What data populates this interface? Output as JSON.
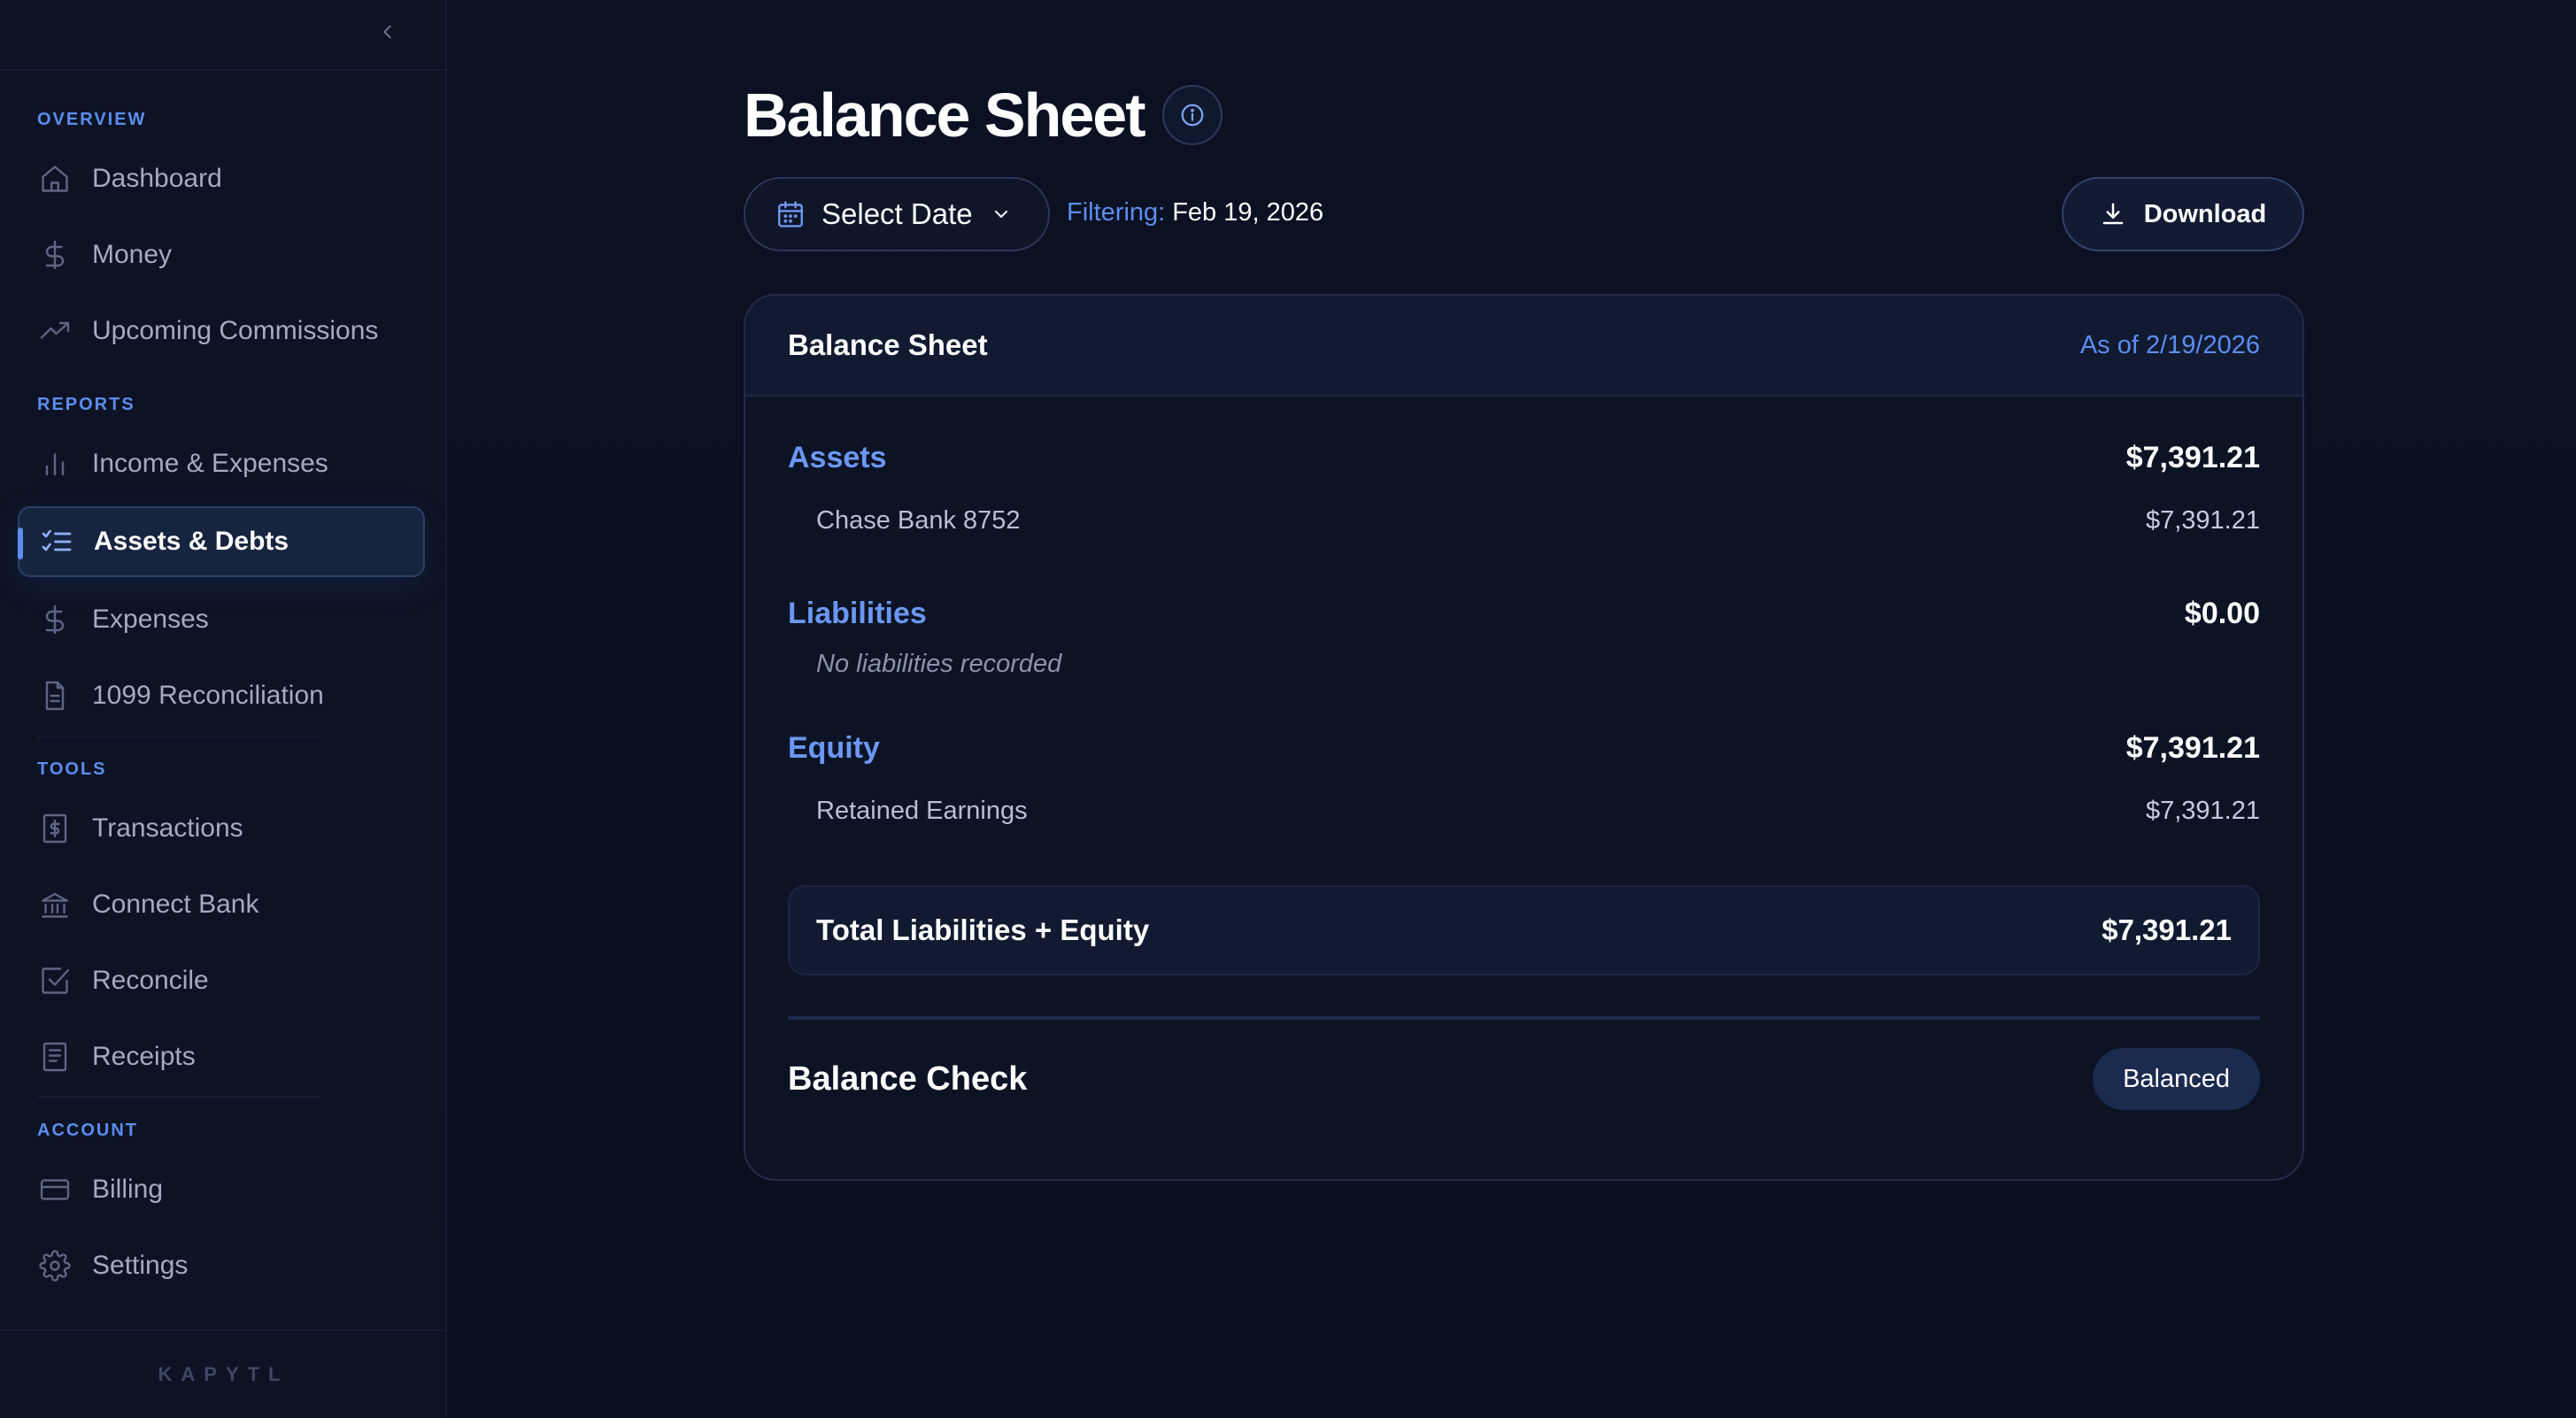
{
  "sidebar": {
    "sections": {
      "overview": "OVERVIEW",
      "reports": "REPORTS",
      "tools": "TOOLS",
      "account": "ACCOUNT"
    },
    "items": {
      "dashboard": "Dashboard",
      "money": "Money",
      "upcoming_commissions": "Upcoming Commissions",
      "income_expenses": "Income & Expenses",
      "assets_debts": "Assets & Debts",
      "expenses": "Expenses",
      "reconciliation_1099": "1099 Reconciliation",
      "transactions": "Transactions",
      "connect_bank": "Connect Bank",
      "reconcile": "Reconcile",
      "receipts": "Receipts",
      "billing": "Billing",
      "settings": "Settings"
    },
    "active_item": "Assets & Debts",
    "brand": "KAPYTL"
  },
  "header": {
    "title": "Balance Sheet",
    "date_select_label": "Select Date",
    "filtering_label": "Filtering:",
    "filtering_value": "Feb 19, 2026",
    "download_label": "Download"
  },
  "card": {
    "title": "Balance Sheet",
    "as_of": "As of 2/19/2026",
    "assets": {
      "title": "Assets",
      "total": "$7,391.21",
      "items": [
        {
          "label": "Chase Bank 8752",
          "amount": "$7,391.21"
        }
      ]
    },
    "liabilities": {
      "title": "Liabilities",
      "total": "$0.00",
      "empty_note": "No liabilities recorded"
    },
    "equity": {
      "title": "Equity",
      "total": "$7,391.21",
      "items": [
        {
          "label": "Retained Earnings",
          "amount": "$7,391.21"
        }
      ]
    },
    "total_label": "Total Liabilities + Equity",
    "total_amount": "$7,391.21",
    "balance_check_label": "Balance Check",
    "balance_status": "Balanced"
  },
  "colors": {
    "accent": "#5b8def",
    "background": "#0b1020",
    "active_nav_bg": "#172440",
    "badge_bg": "#1b2a4f"
  },
  "icons": {
    "collapse": "chevron-left-icon",
    "dashboard": "home-icon",
    "money": "dollar-icon",
    "upcoming_commissions": "trend-up-icon",
    "income_expenses": "bar-chart-icon",
    "assets_debts": "checklist-icon",
    "expenses": "dollar-icon",
    "reconciliation_1099": "document-icon",
    "transactions": "receipt-dollar-icon",
    "connect_bank": "bank-icon",
    "reconcile": "check-square-icon",
    "receipts": "receipt-icon",
    "billing": "credit-card-icon",
    "settings": "gear-icon",
    "info": "info-icon",
    "calendar": "calendar-icon",
    "download": "download-icon"
  }
}
